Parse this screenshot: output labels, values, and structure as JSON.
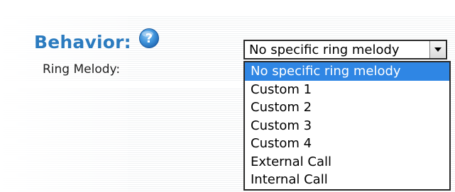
{
  "section": {
    "title": "Behavior:",
    "help_icon": "help-icon"
  },
  "ring_melody": {
    "label": "Ring Melody:",
    "selected_value": "No specific ring melody",
    "options": [
      "No specific ring melody",
      "Custom 1",
      "Custom 2",
      "Custom 3",
      "Custom 4",
      "External Call",
      "Internal Call"
    ],
    "highlighted_index": 0
  },
  "colors": {
    "title": "#2b7bbf",
    "selection": "#2f86e4",
    "text": "#1f1f1f"
  }
}
